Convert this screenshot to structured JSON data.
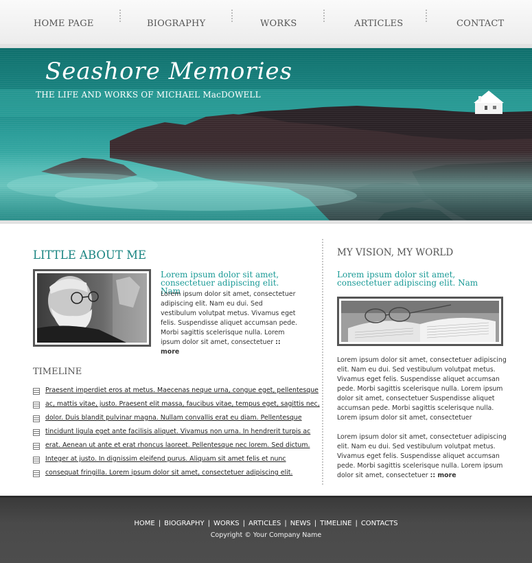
{
  "nav": {
    "items": [
      "HOME PAGE",
      "BIOGRAPHY",
      "WORKS",
      "ARTICLES",
      "CONTACT"
    ]
  },
  "banner": {
    "title": "Seashore Memories",
    "subtitle": "THE LIFE AND WORKS OF MICHAEL MacDOWELL"
  },
  "about": {
    "heading": "LITTLE ABOUT ME",
    "intro_heading": "Lorem ipsum dolor sit amet, consectetuer adipiscing elit. Nam",
    "intro_body": "Lorem ipsum dolor sit amet, consectetuer adipiscing elit. Nam eu dui. Sed vestibulum volutpat metus. Vivamus eget felis. Suspendisse aliquet accumsan pede. Morbi sagittis scelerisque nulla. Lorem ipsum dolor sit amet, consectetuer",
    "more_label": ":: more"
  },
  "timeline": {
    "heading": "TIMELINE",
    "items": [
      "Praesent imperdiet eros at metus. Maecenas neque urna, congue eget, pellentesque",
      "ac, mattis vitae, justo. Praesent elit massa, faucibus vitae, tempus eget, sagittis nec,",
      "dolor. Duis blandit pulvinar magna. Nullam convallis erat eu diam. Pellentesque",
      "tincidunt ligula eget ante facilisis aliquet. Vivamus non urna. In hendrerit turpis ac",
      "erat. Aenean ut ante et erat rhoncus laoreet. Pellentesque nec lorem. Sed dictum.",
      "Integer at justo. In dignissim eleifend purus. Aliquam sit amet felis et nunc",
      "consequat fringilla. Lorem ipsum dolor sit amet, consectetuer adipiscing elit."
    ]
  },
  "vision": {
    "heading": "MY VISION, MY WORLD",
    "subheading": "Lorem ipsum dolor sit amet, consectetuer adipiscing elit. Nam",
    "paragraph1": "Lorem ipsum dolor sit amet, consectetuer adipiscing elit. Nam eu dui. Sed vestibulum volutpat metus. Vivamus eget felis. Suspendisse aliquet accumsan pede. Morbi sagittis scelerisque nulla. Lorem ipsum dolor sit amet, consectetuer Suspendisse aliquet accumsan pede. Morbi sagittis scelerisque nulla. Lorem ipsum dolor sit amet, consectetuer",
    "paragraph2": "Lorem ipsum dolor sit amet, consectetuer adipiscing elit. Nam eu dui. Sed vestibulum volutpat metus. Vivamus eget felis. Suspendisse aliquet accumsan pede. Morbi sagittis scelerisque nulla. Lorem ipsum dolor sit amet, consectetuer",
    "more_label": ":: more"
  },
  "footer": {
    "links": [
      "HOME",
      "BIOGRAPHY",
      "WORKS",
      "ARTICLES",
      "NEWS",
      "TIMELINE",
      "CONTACTS"
    ],
    "separator": "|",
    "copyright": "Copyright © Your Company Name"
  },
  "colors": {
    "accent_teal": "#1a8582",
    "footer_bg": "#4a4a4a"
  }
}
